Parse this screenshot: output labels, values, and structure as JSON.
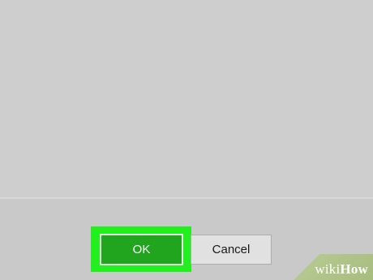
{
  "dialog": {
    "buttons": {
      "ok_label": "OK",
      "cancel_label": "Cancel"
    }
  },
  "watermark": {
    "wiki": "wiki",
    "how": "How"
  },
  "colors": {
    "highlight": "#22f01e",
    "ok_button": "#21a51f",
    "background": "#cfcfcf"
  }
}
